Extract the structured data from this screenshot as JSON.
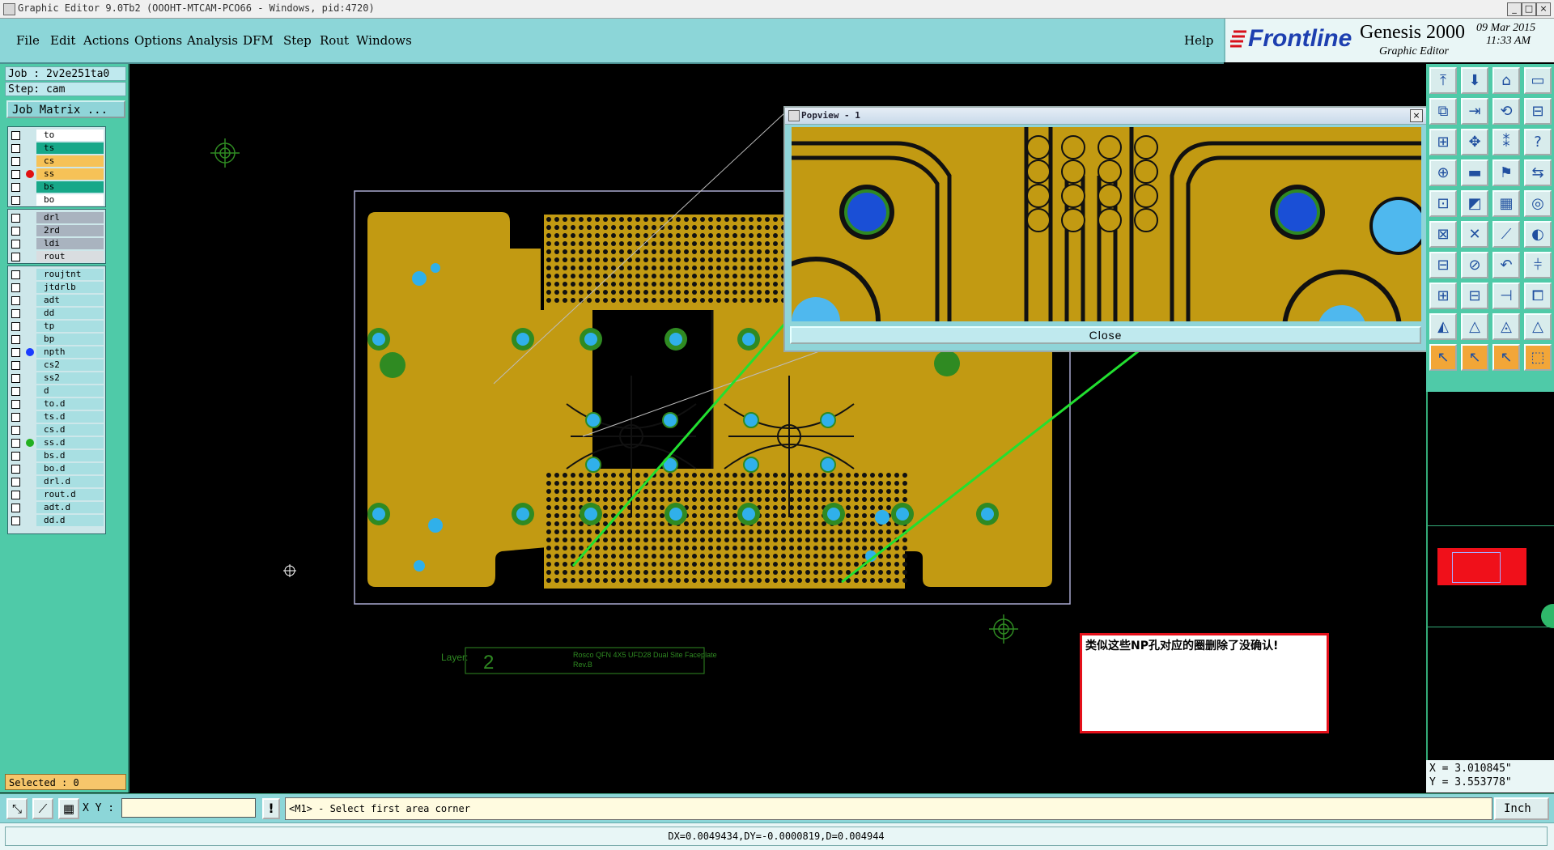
{
  "window": {
    "title": "Graphic Editor 9.0Tb2 (OOOHT-MTCAM-PCO66 - Windows, pid:4720)",
    "controls": [
      "_",
      "□",
      "×"
    ]
  },
  "menu": {
    "items": [
      "File",
      "Edit",
      "Actions",
      "Options",
      "Analysis",
      "DFM",
      "Step",
      "Rout",
      "Windows"
    ],
    "help": "Help"
  },
  "brand": {
    "logo": "Frontline",
    "product": "Genesis 2000",
    "subtitle": "Graphic Editor",
    "date": "09 Mar 2015",
    "time": "11:33 AM"
  },
  "job": {
    "job_label": "Job : 2v2e251ta0",
    "step_label": "Step: cam",
    "matrix_button": "Job Matrix ..."
  },
  "layers": {
    "group1": [
      {
        "name": "to",
        "color": "#ffffff",
        "dot": ""
      },
      {
        "name": "ts",
        "color": "#17a889",
        "dot": ""
      },
      {
        "name": "cs",
        "color": "#f6c257",
        "dot": ""
      },
      {
        "name": "ss",
        "color": "#f6c257",
        "dot": "#e01010"
      },
      {
        "name": "bs",
        "color": "#17a889",
        "dot": ""
      },
      {
        "name": "bo",
        "color": "#ffffff",
        "dot": ""
      }
    ],
    "group2": [
      {
        "name": "drl",
        "color": "#a9b3bf",
        "dot": ""
      },
      {
        "name": "2rd",
        "color": "#a9b3bf",
        "dot": ""
      },
      {
        "name": "ldi",
        "color": "#a9b3bf",
        "dot": ""
      },
      {
        "name": "rout",
        "color": "#d9dde0",
        "dot": ""
      }
    ],
    "group3": [
      {
        "name": "roujtnt",
        "color": "#a8dfe2",
        "dot": ""
      },
      {
        "name": "jtdrlb",
        "color": "#a8dfe2",
        "dot": ""
      },
      {
        "name": "adt",
        "color": "#a8dfe2",
        "dot": ""
      },
      {
        "name": "dd",
        "color": "#a8dfe2",
        "dot": ""
      },
      {
        "name": "tp",
        "color": "#a8dfe2",
        "dot": ""
      },
      {
        "name": "bp",
        "color": "#a8dfe2",
        "dot": ""
      },
      {
        "name": "npth",
        "color": "#a8dfe2",
        "dot": "#1a3cff"
      },
      {
        "name": "cs2",
        "color": "#a8dfe2",
        "dot": ""
      },
      {
        "name": "ss2",
        "color": "#a8dfe2",
        "dot": ""
      },
      {
        "name": "d",
        "color": "#a8dfe2",
        "dot": ""
      },
      {
        "name": "to.d",
        "color": "#a8dfe2",
        "dot": ""
      },
      {
        "name": "ts.d",
        "color": "#a8dfe2",
        "dot": ""
      },
      {
        "name": "cs.d",
        "color": "#a8dfe2",
        "dot": ""
      },
      {
        "name": "ss.d",
        "color": "#a8dfe2",
        "dot": "#22b020"
      },
      {
        "name": "bs.d",
        "color": "#a8dfe2",
        "dot": ""
      },
      {
        "name": "bo.d",
        "color": "#a8dfe2",
        "dot": ""
      },
      {
        "name": "drl.d",
        "color": "#a8dfe2",
        "dot": ""
      },
      {
        "name": "rout.d",
        "color": "#a8dfe2",
        "dot": ""
      },
      {
        "name": "adt.d",
        "color": "#a8dfe2",
        "dot": ""
      },
      {
        "name": "dd.d",
        "color": "#a8dfe2",
        "dot": ""
      }
    ]
  },
  "selected": "Selected : 0",
  "popview": {
    "title": "Popview - 1",
    "close_label": "Close"
  },
  "annotation": {
    "text": "类似这些NP孔对应的圈删除了没确认!"
  },
  "canvas": {
    "layer_label": "Layer:",
    "layer_number": "2",
    "plate_text_1": "Rosco QFN 4X5 UFD28 Dual Site Faceplate",
    "plate_text_2": "Rev.B"
  },
  "coords": {
    "x": "X = 3.010845\"",
    "y": "Y = 3.553778\""
  },
  "bottom": {
    "xy_label": "X Y :",
    "xy_value": "",
    "prompt": "<M1> - Select first area corner",
    "units": "Inch"
  },
  "status": {
    "measure": "DX=0.0049434,DY=-0.0000819,D=0.004944"
  },
  "colors": {
    "copper": "#c29a12",
    "panel": "#4fcaa8",
    "menu": "#8cd6d8",
    "accent_red": "#e4101a"
  }
}
